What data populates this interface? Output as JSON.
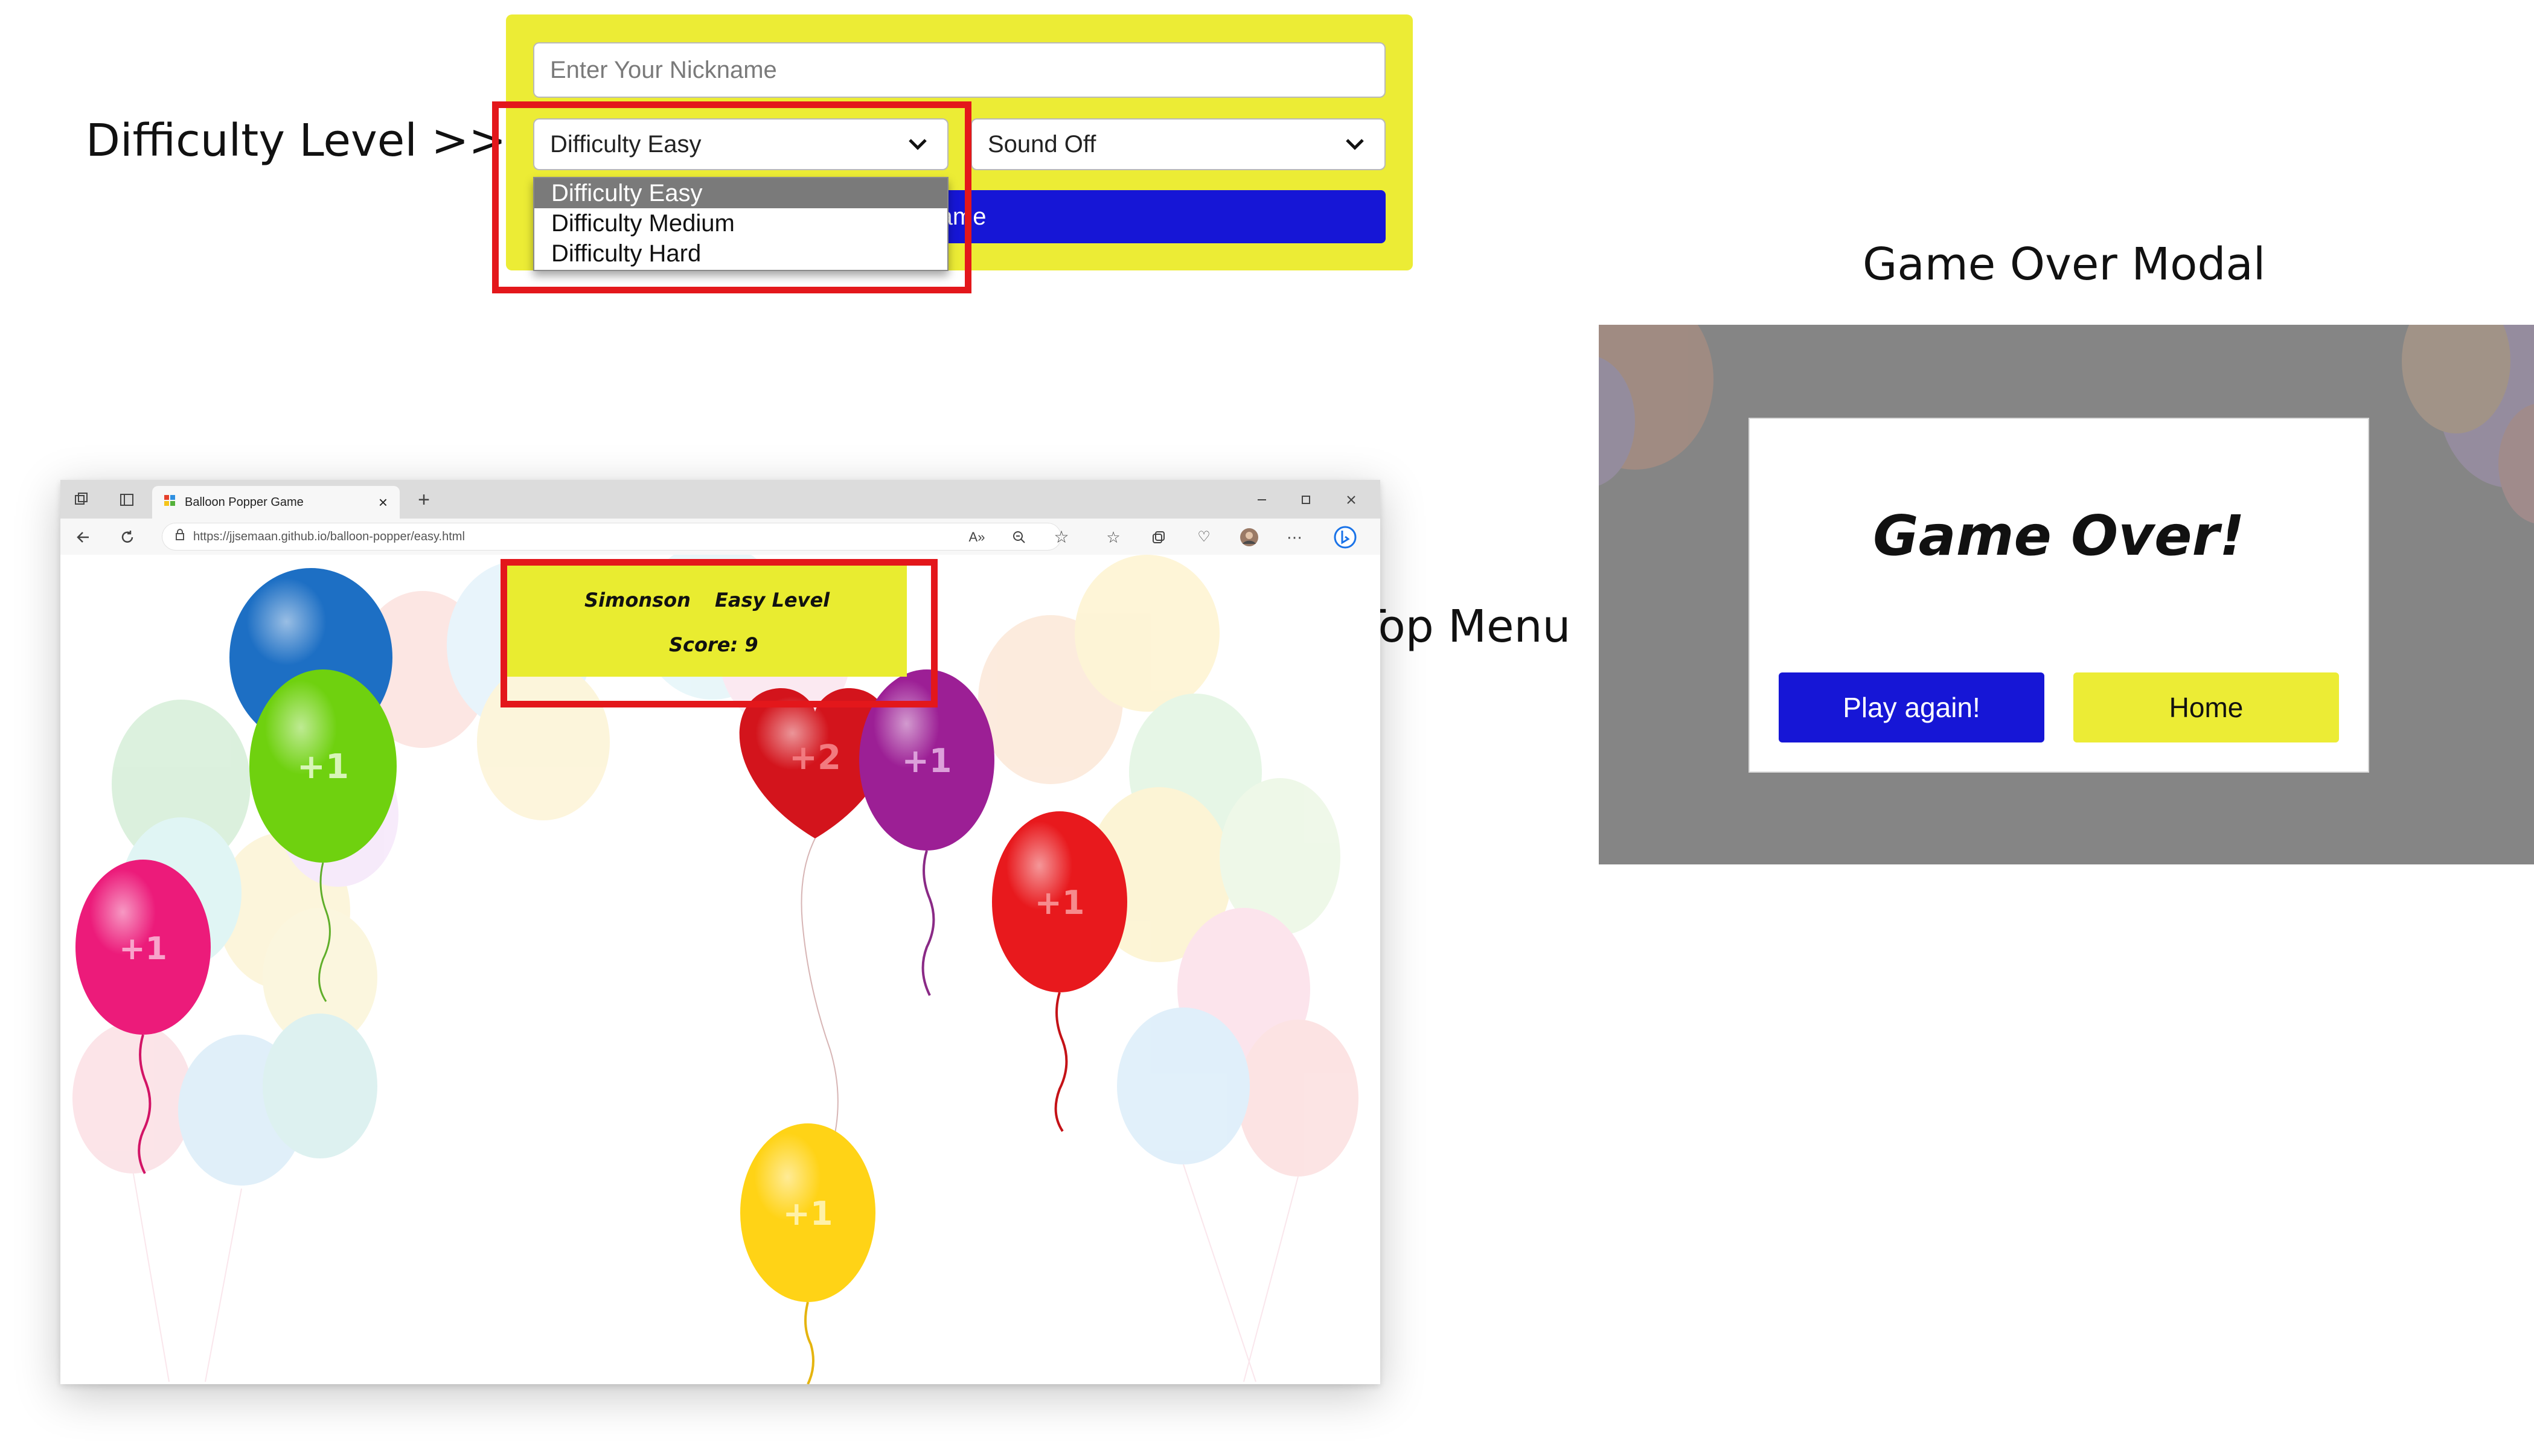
{
  "annotations": {
    "difficulty_label": "Difficulty Level >>>",
    "game_over_label": "Game Over Modal",
    "top_menu_label": "<<< Responsive Top Menu"
  },
  "setup_form": {
    "nickname_placeholder": "Enter Your Nickname",
    "difficulty_selected": "Difficulty Easy",
    "sound_selected": "Sound Off",
    "start_button_visible_text": "Game",
    "difficulty_options": [
      "Difficulty Easy",
      "Difficulty Medium",
      "Difficulty Hard"
    ]
  },
  "browser": {
    "tab_title": "Balloon Popper Game",
    "url": "https://jjsemaan.github.io/balloon-popper/easy.html",
    "window_controls": [
      "minimize-icon",
      "maximize-icon",
      "close-icon"
    ],
    "toolbar_icons": [
      "read-aloud-icon",
      "zoom-icon",
      "favorite-star-icon",
      "favorites-icon",
      "collections-icon",
      "extensions-icon",
      "profile-avatar",
      "more-icon",
      "bing-icon"
    ]
  },
  "game": {
    "player_name": "Simonson",
    "level": "Easy Level",
    "score_text": "Score: 9",
    "balloons": [
      {
        "color": "#1d6fc4",
        "label": "+1"
      },
      {
        "color": "#6fd10f",
        "label": "+1"
      },
      {
        "color": "#ec1b7a",
        "label": "+1"
      },
      {
        "color": "#d3141c",
        "label": "+2"
      },
      {
        "color": "#9c1f95",
        "label": "+1"
      },
      {
        "color": "#e8191d",
        "label": "+1"
      },
      {
        "color": "#ffd316",
        "label": "+1"
      }
    ]
  },
  "modal": {
    "title": "Game Over!",
    "play_again": "Play again!",
    "home": "Home"
  },
  "colors": {
    "yellow": "#ecec35",
    "blue": "#1616d6",
    "annotation_red": "#e3171b",
    "overlay_gray": "#858585"
  }
}
